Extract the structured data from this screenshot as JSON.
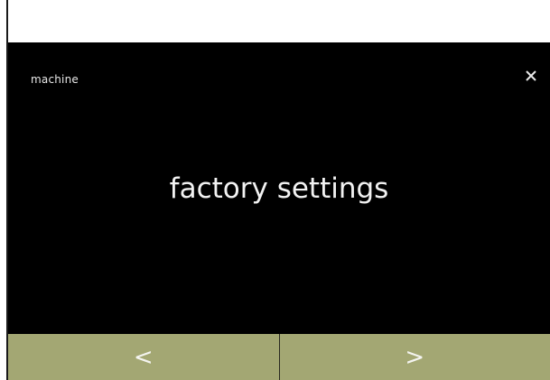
{
  "header": {
    "section_label": "machine",
    "close_icon": "close-icon"
  },
  "main": {
    "title": "factory settings"
  },
  "navigation": {
    "prev_label": "<",
    "next_label": ">"
  },
  "colors": {
    "screen_background": "#000000",
    "nav_bar": "#a3a773",
    "text": "#f2f2f2"
  }
}
